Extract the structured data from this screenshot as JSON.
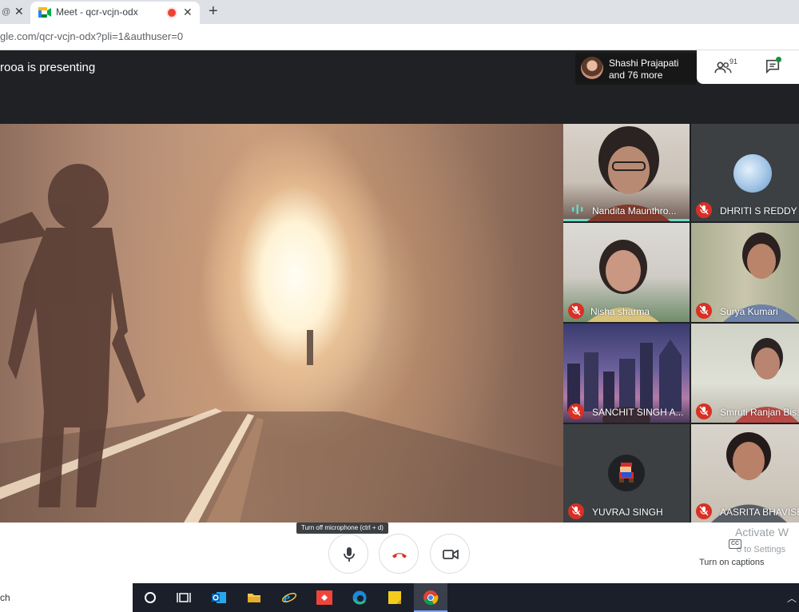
{
  "browser": {
    "prev_tab_fragment": "@",
    "active_tab_title": "Meet - qcr-vcjn-odx",
    "new_tab_symbol": "+",
    "url": "gle.com/qcr-vcjn-odx?pli=1&authuser=0"
  },
  "meet": {
    "presenting_text": "rooa is presenting",
    "pinned_name": "Shashi Prajapati",
    "pinned_more": "and 76 more",
    "participant_count": "91",
    "accent_color": "#66d9c8",
    "mute_color": "#d93025"
  },
  "participants": [
    {
      "name": "Nandita Maunthro...",
      "muted": false,
      "speaking": true
    },
    {
      "name": "DHRITI S REDDY",
      "muted": true
    },
    {
      "name": "Nisha sharma",
      "muted": true
    },
    {
      "name": "Surya Kumari",
      "muted": true
    },
    {
      "name": "SANCHIT SINGH A...",
      "muted": true
    },
    {
      "name": "Smruti Ranjan Bis...",
      "muted": true
    },
    {
      "name": "YUVRAJ SINGH",
      "muted": true
    },
    {
      "name": "AASRITA BHAVISE",
      "muted": true
    }
  ],
  "controls": {
    "mic_tooltip": "Turn off microphone (ctrl + d)",
    "captions_label": "Turn on captions",
    "cc_text": "CC"
  },
  "watermark": {
    "line1": "Activate W",
    "line2": "o to Settings"
  },
  "taskbar": {
    "search_fragment": "ch",
    "icons": [
      "task-view-icon",
      "outlook-icon",
      "file-explorer-icon",
      "internet-explorer-icon",
      "anydesk-icon",
      "edge-icon",
      "sticky-notes-icon",
      "chrome-icon"
    ]
  }
}
